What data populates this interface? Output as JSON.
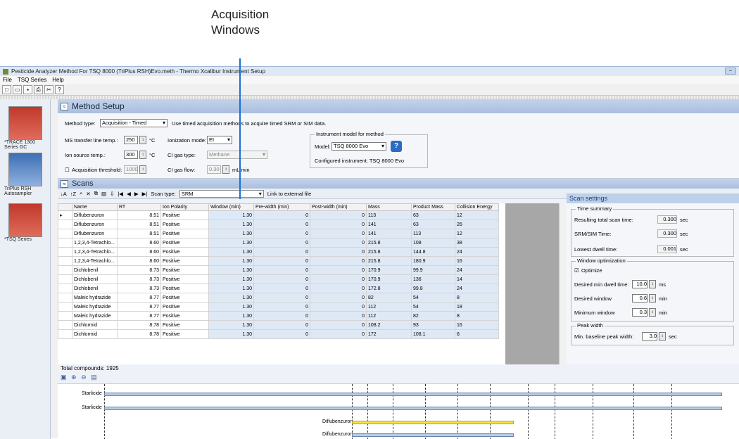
{
  "callout": {
    "line1": "Acquisition",
    "line2": "Windows"
  },
  "window": {
    "title": "Pesticide Analyzer Method For TSQ 8000 (TriPlus RSH)Evo.meth - Thermo Xcalibur Instrument Setup"
  },
  "menu": [
    "File",
    "TSQ Series",
    "Help"
  ],
  "toolbar_icons": [
    "new-icon",
    "open-icon",
    "save-icon",
    "print-icon",
    "cut-icon",
    "help-icon"
  ],
  "devices": [
    {
      "label": "*TRACE 1300 Series GC",
      "color": "#c0392b"
    },
    {
      "label": "TriPlus RSH Autosampler",
      "color": "#3d6fb3"
    },
    {
      "label": "*TSQ Series",
      "color": "#c0392b"
    }
  ],
  "method_setup": {
    "title": "Method Setup",
    "method_type_label": "Method type:",
    "method_type_value": "Acquisition - Timed",
    "method_type_desc": "Use timed acquisition methods to acquire timed SRM or SIM data.",
    "ms_transfer_label": "MS transfer line temp.:",
    "ms_transfer_value": "250",
    "unit_c": "°C",
    "ion_source_label": "Ion source temp.:",
    "ion_source_value": "300",
    "acq_threshold_label": "Acquisition threshold:",
    "acq_threshold_value": "1000",
    "ionization_label": "Ionization mode:",
    "ionization_value": "EI",
    "ci_gas_type_label": "CI gas type:",
    "ci_gas_type_value": "Methane",
    "ci_gas_flow_label": "CI gas flow:",
    "ci_gas_flow_value": "0.30",
    "ci_gas_flow_unit": "mL/min",
    "instrument_group": "Instrument model for method",
    "model_label": "Model:",
    "model_value": "TSQ 8000 Evo",
    "configured": "Configured instrument: TSQ 8000 Evo"
  },
  "scans": {
    "title": "Scans",
    "scan_type_label": "Scan type:",
    "scan_type_value": "SRM",
    "link_label": "Link to external file",
    "columns": [
      "Name",
      "RT",
      "Ion Polarity",
      "Window (min)",
      "Pre-width (min)",
      "Post-width (min)",
      "Mass",
      "Product Mass",
      "Collision Energy"
    ],
    "rows": [
      [
        "Diflubenzuron",
        "8.51",
        "Positive",
        "1.30",
        "0",
        "0",
        "113",
        "63",
        "12"
      ],
      [
        "Diflubenzuron",
        "8.51",
        "Positive",
        "1.30",
        "0",
        "0",
        "141",
        "63",
        "26"
      ],
      [
        "Diflubenzuron",
        "8.51",
        "Positive",
        "1.30",
        "0",
        "0",
        "141",
        "113",
        "12"
      ],
      [
        "1,2,3,4-Tetrachlo...",
        "8.60",
        "Positive",
        "1.30",
        "0",
        "0",
        "215.8",
        "108",
        "38"
      ],
      [
        "1,2,3,4-Tetrachlo...",
        "8.60",
        "Positive",
        "1.30",
        "0",
        "0",
        "215.8",
        "144.8",
        "24"
      ],
      [
        "1,2,3,4-Tetrachlo...",
        "8.60",
        "Positive",
        "1.30",
        "0",
        "0",
        "215.8",
        "180.9",
        "16"
      ],
      [
        "Dichlobenil",
        "8.73",
        "Positive",
        "1.30",
        "0",
        "0",
        "170.9",
        "99.9",
        "24"
      ],
      [
        "Dichlobenil",
        "8.73",
        "Positive",
        "1.30",
        "0",
        "0",
        "170.9",
        "136",
        "14"
      ],
      [
        "Dichlobenil",
        "8.73",
        "Positive",
        "1.30",
        "0",
        "0",
        "172.8",
        "99.8",
        "24"
      ],
      [
        "Maleic hydrazide",
        "8.77",
        "Positive",
        "1.30",
        "0",
        "0",
        "82",
        "54",
        "8"
      ],
      [
        "Maleic hydrazide",
        "8.77",
        "Positive",
        "1.30",
        "0",
        "0",
        "112",
        "54",
        "18"
      ],
      [
        "Maleic hydrazide",
        "8.77",
        "Positive",
        "1.30",
        "0",
        "0",
        "112",
        "82",
        "8"
      ],
      [
        "Dichlormid",
        "8.78",
        "Positive",
        "1.30",
        "0",
        "0",
        "108.2",
        "93",
        "16"
      ],
      [
        "Dichlormid",
        "8.78",
        "Positive",
        "1.30",
        "0",
        "0",
        "172",
        "108.1",
        "6"
      ]
    ],
    "total": "Total compounds: 1925"
  },
  "scan_settings": {
    "title": "Scan settings",
    "time_summary": "Time summary",
    "total_scan_label": "Resulting total scan time:",
    "total_scan_value": "0.300",
    "srm_time_label": "SRM/SIM Time:",
    "srm_time_value": "0.300",
    "dwell_label": "Lowest dwell time:",
    "dwell_value": "0.001",
    "unit_sec": "sec",
    "window_opt": "Window optimization",
    "optimize_label": "Optimize",
    "min_dwell_label": "Desired min dwell time:",
    "min_dwell_value": "10.0",
    "unit_ms": "ms",
    "desired_window_label": "Desired window",
    "desired_window_value": "0.6",
    "unit_min": "min",
    "min_window_label": "Minimum window",
    "min_window_value": "0.3",
    "peak_width": "Peak width",
    "baseline_label": "Min. baseline peak width:",
    "baseline_value": "3.0"
  },
  "timeline": {
    "labels": [
      "Starlicide",
      "Starlicide",
      "Diflubenzuron",
      "Diflubenzuron"
    ]
  }
}
